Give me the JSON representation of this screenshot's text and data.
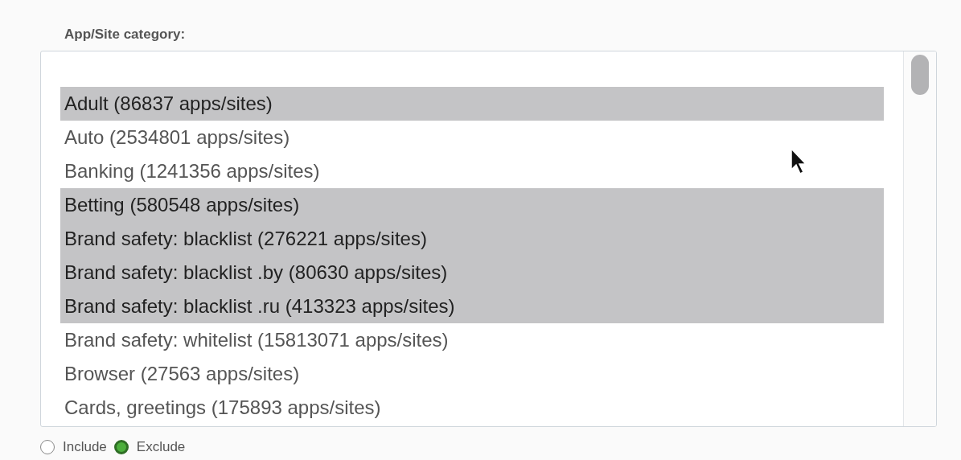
{
  "label": "App/Site category:",
  "categories": [
    {
      "label": "Adult (86837 apps/sites)",
      "selected": true
    },
    {
      "label": "Auto (2534801 apps/sites)",
      "selected": false
    },
    {
      "label": "Banking (1241356 apps/sites)",
      "selected": false
    },
    {
      "label": "Betting (580548 apps/sites)",
      "selected": true
    },
    {
      "label": "Brand safety: blacklist (276221 apps/sites)",
      "selected": true
    },
    {
      "label": "Brand safety: blacklist .by (80630 apps/sites)",
      "selected": true
    },
    {
      "label": "Brand safety: blacklist .ru (413323 apps/sites)",
      "selected": true
    },
    {
      "label": "Brand safety: whitelist (15813071 apps/sites)",
      "selected": false
    },
    {
      "label": "Browser (27563 apps/sites)",
      "selected": false
    },
    {
      "label": "Cards, greetings (175893 apps/sites)",
      "selected": false
    }
  ],
  "mode": [
    {
      "label": "Include",
      "selected": false
    },
    {
      "label": "Exclude",
      "selected": true
    }
  ]
}
